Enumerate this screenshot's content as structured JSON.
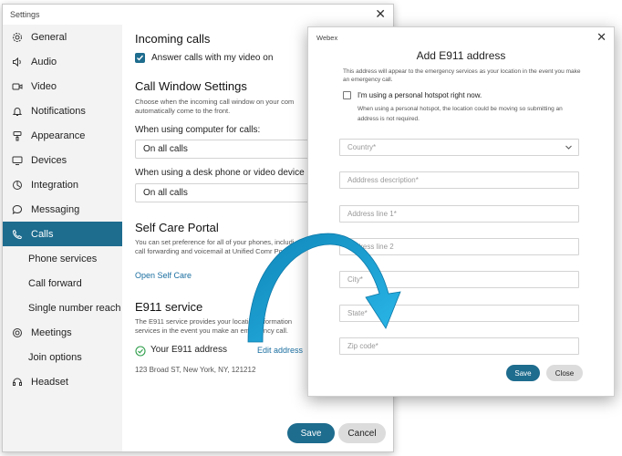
{
  "settings": {
    "title": "Settings",
    "sidebar": {
      "items": [
        {
          "label": "General",
          "icon": "gear-icon"
        },
        {
          "label": "Audio",
          "icon": "speaker-icon"
        },
        {
          "label": "Video",
          "icon": "video-camera-icon"
        },
        {
          "label": "Notifications",
          "icon": "bell-icon"
        },
        {
          "label": "Appearance",
          "icon": "paint-icon"
        },
        {
          "label": "Devices",
          "icon": "monitor-icon"
        },
        {
          "label": "Integration",
          "icon": "plug-icon"
        },
        {
          "label": "Messaging",
          "icon": "chat-bubble-icon"
        },
        {
          "label": "Calls",
          "icon": "phone-icon",
          "active": true
        },
        {
          "label": "Phone services",
          "sub": true
        },
        {
          "label": "Call forward",
          "sub": true
        },
        {
          "label": "Single number reach",
          "sub": true
        },
        {
          "label": "Meetings",
          "icon": "meetings-icon"
        },
        {
          "label": "Join options",
          "sub": true
        },
        {
          "label": "Headset",
          "icon": "headset-icon"
        }
      ]
    },
    "content": {
      "incoming_title": "Incoming calls",
      "answer_video_label": "Answer calls with my video on",
      "call_window_title": "Call Window Settings",
      "call_window_desc": "Choose when the incoming call window on your com automatically come to the front.",
      "computer_label": "When using computer for calls:",
      "computer_value": "On all calls",
      "desk_label": "When using a desk phone or video device",
      "desk_value": "On all calls",
      "self_care_title": "Self Care Portal",
      "self_care_desc": "You can set preference for all of your phones, includi reach, call forwarding and voicemail at Unified Comr Portal.",
      "open_self_care": "Open Self Care",
      "e911_title": "E911 service",
      "e911_desc": "The E911 service provides your location information services in the event you make an emergency call.",
      "e911_label": "Your E911 address",
      "edit_address": "Edit address",
      "address_value": "123 Broad ST, New York, NY, 121212"
    },
    "save_label": "Save",
    "cancel_label": "Cancel"
  },
  "dialog": {
    "brand": "Webex",
    "title": "Add E911 address",
    "description": "This address will appear to the emergency services as your location in the event you make an emergency call.",
    "hotspot_label": "I'm using a personal hotspot right now.",
    "hotspot_note": "When using a personal hotspot, the location could be moving so submitting an address is not required.",
    "fields": [
      {
        "placeholder": "Country*"
      },
      {
        "placeholder": "Adddress description*"
      },
      {
        "placeholder": "Address line 1*"
      },
      {
        "placeholder": "Address line 2"
      },
      {
        "placeholder": "City*"
      },
      {
        "placeholder": "State*"
      },
      {
        "placeholder": "Zip code*"
      }
    ],
    "save_label": "Save",
    "close_label": "Close"
  },
  "colors": {
    "accent": "#1e6c8e",
    "arrow": "#1ba6d9",
    "link": "#1a6ea0"
  }
}
